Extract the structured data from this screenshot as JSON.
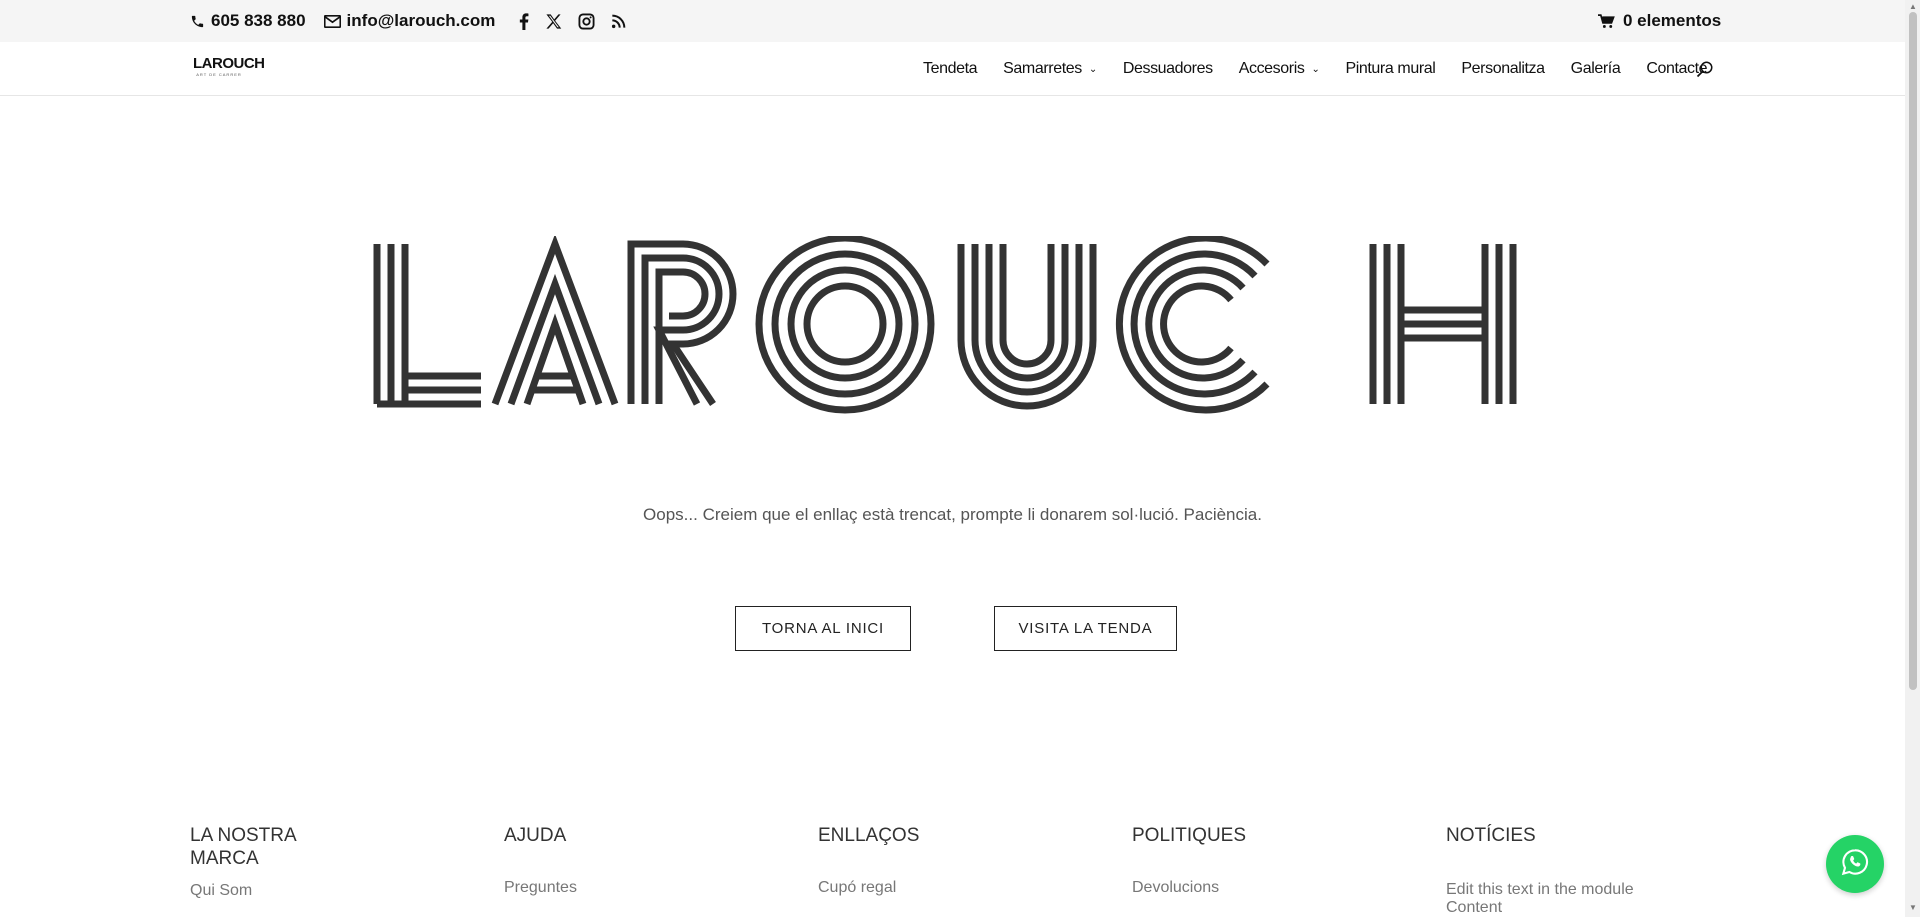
{
  "topbar": {
    "phone": "605 838 880",
    "email": "info@larouch.com",
    "social_icons": [
      "facebook-icon",
      "x-icon",
      "instagram-icon",
      "rss-icon"
    ],
    "cart": "0 elementos"
  },
  "header": {
    "logo_text": "LAROUCH",
    "logo_tagline": "ART DE CARRER",
    "nav": [
      {
        "label": "Tendeta",
        "has_dropdown": false
      },
      {
        "label": "Samarretes",
        "has_dropdown": true
      },
      {
        "label": "Dessuadores",
        "has_dropdown": false
      },
      {
        "label": "Accesoris",
        "has_dropdown": true
      },
      {
        "label": "Pintura mural",
        "has_dropdown": false
      },
      {
        "label": "Personalitza",
        "has_dropdown": false
      },
      {
        "label": "Galería",
        "has_dropdown": false
      },
      {
        "label": "Contacte",
        "has_dropdown": false
      }
    ],
    "search_icon": "search-icon"
  },
  "hero": {
    "brand": "LAROUCH",
    "message": "Oops... Creiem que el enllaç està trencat, prompte li donarem sol·lució. Paciència.",
    "btn_home": "TORNA AL INICI",
    "btn_shop": "VISITA LA TENDA"
  },
  "footer": {
    "columns": [
      {
        "title": "LA NOSTRA MARCA",
        "links": [
          "Qui Som"
        ]
      },
      {
        "title": "AJUDA",
        "links": [
          "Preguntes"
        ]
      },
      {
        "title": "ENLLAÇOS",
        "links": [
          "Cupó regal"
        ]
      },
      {
        "title": "POLITIQUES",
        "links": [
          "Devolucions"
        ]
      },
      {
        "title": "NOTÍCIES",
        "links": [
          "Edit this text in the module Content"
        ]
      }
    ]
  },
  "colors": {
    "topbar_bg": "#f5f5f5",
    "logo_stroke": "#333333",
    "whatsapp": "#25d366"
  }
}
